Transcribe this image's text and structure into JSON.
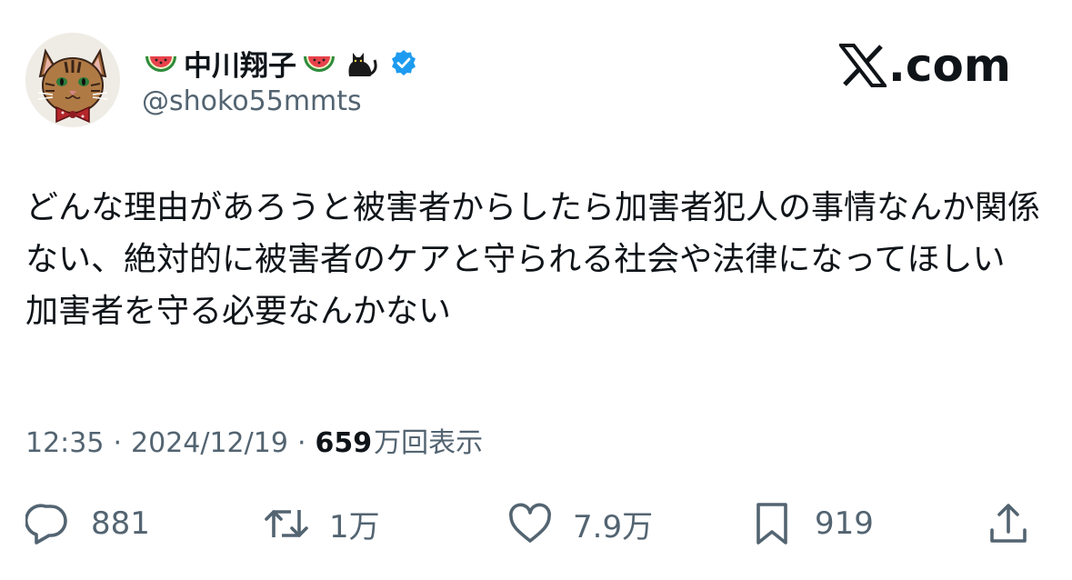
{
  "author": {
    "display_name": "中川翔子",
    "handle": "@shoko55mmts",
    "name_emojis": [
      "watermelon",
      "watermelon",
      "black-cat"
    ],
    "verified": true
  },
  "brand": {
    "logo_text": ".com"
  },
  "tweet": {
    "text": "どんな理由があろうと被害者からしたら加害者犯人の事情なんか関係ない、絶対的に被害者のケアと守られる社会や法律になってほしい　加害者を守る必要なんかない"
  },
  "meta": {
    "time": "12:35",
    "separator": "·",
    "date": "2024/12/19",
    "views_number": "659",
    "views_suffix": "万回表示"
  },
  "actions": {
    "replies": "881",
    "reposts": "1万",
    "likes": "7.9万",
    "bookmarks": "919"
  },
  "colors": {
    "text": "#0f1419",
    "secondary": "#536471",
    "verified": "#1d9bf0"
  }
}
